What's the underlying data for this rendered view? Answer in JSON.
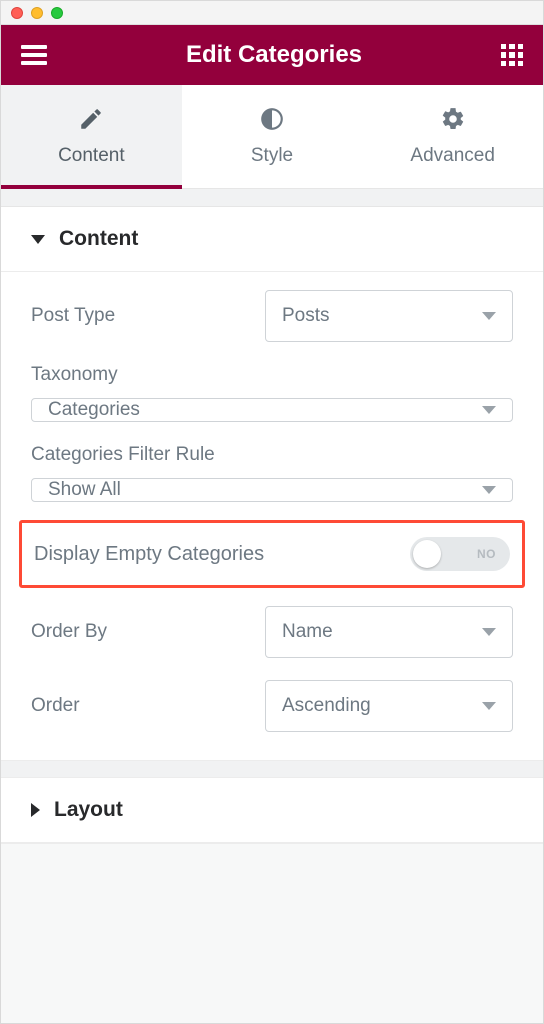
{
  "header": {
    "title": "Edit Categories"
  },
  "tabs": {
    "content": "Content",
    "style": "Style",
    "advanced": "Advanced",
    "active": "content"
  },
  "sections": {
    "content": {
      "title": "Content",
      "fields": {
        "postType": {
          "label": "Post Type",
          "value": "Posts"
        },
        "taxonomy": {
          "label": "Taxonomy",
          "value": "Categories"
        },
        "filterRule": {
          "label": "Categories Filter Rule",
          "value": "Show All"
        },
        "displayEmpty": {
          "label": "Display Empty Categories",
          "toggle": "NO"
        },
        "orderBy": {
          "label": "Order By",
          "value": "Name"
        },
        "order": {
          "label": "Order",
          "value": "Ascending"
        }
      }
    },
    "layout": {
      "title": "Layout"
    }
  }
}
